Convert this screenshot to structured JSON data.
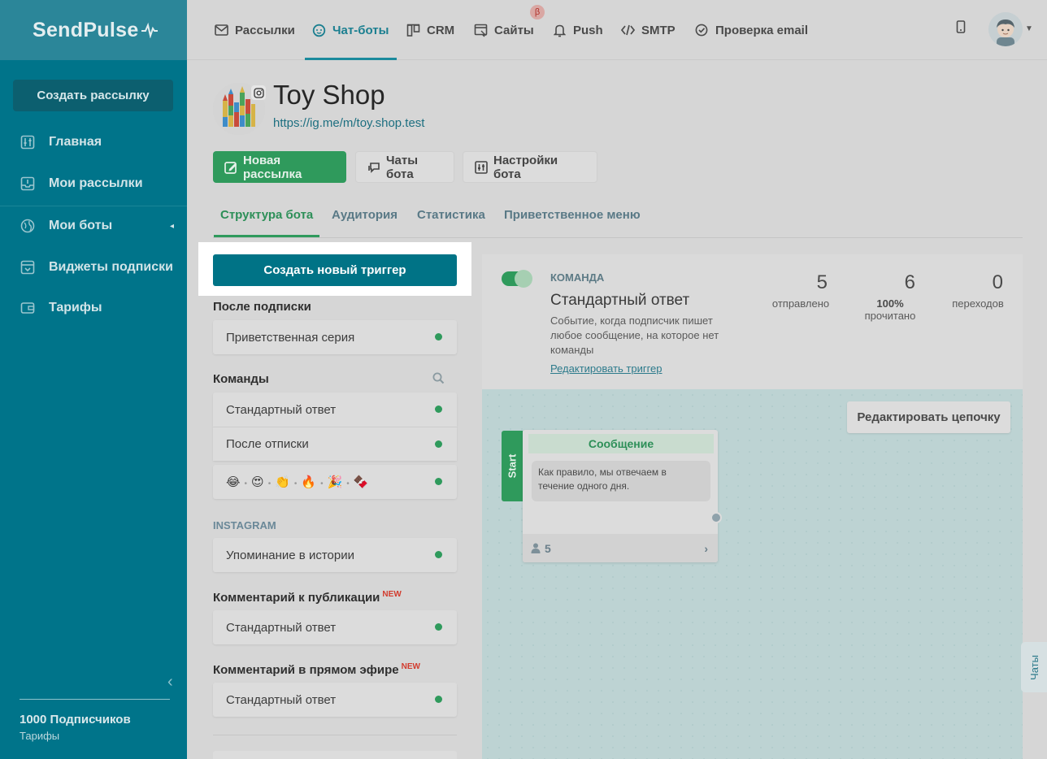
{
  "app": {
    "logo": "SendPulse"
  },
  "sidebar": {
    "create_button": "Создать рассылку",
    "items": [
      {
        "label": "Главная",
        "icon": "sliders-icon"
      },
      {
        "label": "Мои рассылки",
        "icon": "inbox-icon"
      },
      {
        "label": "Мои боты",
        "icon": "globe-icon"
      },
      {
        "label": "Виджеты подписки",
        "icon": "widget-icon"
      },
      {
        "label": "Тарифы",
        "icon": "wallet-icon"
      }
    ],
    "subscribers": "1000 Подписчиков",
    "tariff_link": "Тарифы"
  },
  "topnav": {
    "tabs": [
      {
        "label": "Рассылки",
        "icon": "mail-icon"
      },
      {
        "label": "Чат-боты",
        "icon": "chatbot-icon",
        "active": true
      },
      {
        "label": "CRM",
        "icon": "crm-icon"
      },
      {
        "label": "Сайты",
        "icon": "site-icon"
      },
      {
        "label": "Push",
        "icon": "bell-icon"
      },
      {
        "label": "SMTP",
        "icon": "code-icon"
      },
      {
        "label": "Проверка email",
        "icon": "check-circle-icon"
      }
    ],
    "beta_badge": "β"
  },
  "bot": {
    "name": "Toy Shop",
    "link": "https://ig.me/m/toy.shop.test",
    "buttons": {
      "new_campaign": "Новая рассылка",
      "chats": "Чаты бота",
      "settings": "Настройки бота"
    },
    "tabs": [
      "Структура бота",
      "Аудитория",
      "Статистика",
      "Приветственное меню"
    ]
  },
  "triggers": {
    "create_button": "Создать новый триггер",
    "groups": {
      "after_subscribe": {
        "title": "После подписки",
        "items": [
          "Приветственная серия"
        ]
      },
      "commands": {
        "title": "Команды",
        "items": [
          "Стандартный ответ",
          "После отписки"
        ],
        "emoji": [
          "😂",
          "😍",
          "👏",
          "🔥",
          "🎉",
          "🍫"
        ]
      },
      "instagram": {
        "title": "INSTAGRAM",
        "items": [
          "Упоминание в истории"
        ]
      },
      "post_comment": {
        "title": "Комментарий к публикации",
        "badge": "NEW",
        "items": [
          "Стандартный ответ"
        ]
      },
      "live_comment": {
        "title": "Комментарий в прямом эфире",
        "badge": "NEW",
        "items": [
          "Стандартный ответ"
        ]
      }
    }
  },
  "detail": {
    "enabled": true,
    "kind": "КОМАНДА",
    "title": "Стандартный ответ",
    "description": "Событие, когда подписчик пишет любое сообщение, на которое нет команды",
    "edit_link": "Редактировать триггер",
    "stats": {
      "sent": {
        "value": "5",
        "label": "отправлено"
      },
      "read": {
        "value": "6",
        "percent": "100%",
        "label": "прочитано"
      },
      "clicks": {
        "value": "0",
        "label": "переходов"
      }
    }
  },
  "flow": {
    "edit_chain_button": "Редактировать цепочку",
    "start_label": "Start",
    "node": {
      "header": "Сообщение",
      "text": "Как правило, мы отвечаем в течение одного дня.",
      "count": "5"
    },
    "chats_tab": "Чаты"
  },
  "colors": {
    "sidebar": "#00748a",
    "accent_teal": "#007386",
    "accent_green": "#2f9a5c",
    "badge_red": "#d23c2e"
  }
}
